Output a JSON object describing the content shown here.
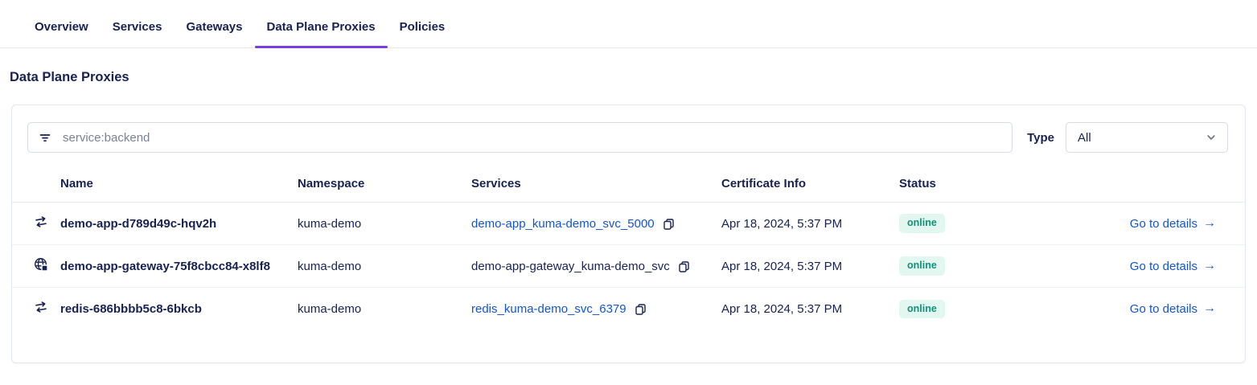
{
  "tabs": [
    {
      "label": "Overview",
      "active": false
    },
    {
      "label": "Services",
      "active": false
    },
    {
      "label": "Gateways",
      "active": false
    },
    {
      "label": "Data Plane Proxies",
      "active": true
    },
    {
      "label": "Policies",
      "active": false
    }
  ],
  "page": {
    "title": "Data Plane Proxies"
  },
  "filter": {
    "placeholder": "service:backend",
    "type_label": "Type",
    "type_value": "All"
  },
  "table": {
    "columns": [
      "Name",
      "Namespace",
      "Services",
      "Certificate Info",
      "Status"
    ],
    "rows": [
      {
        "icon": "proxy-arrows-icon",
        "name": "demo-app-d789d49c-hqv2h",
        "namespace": "kuma-demo",
        "service": "demo-app_kuma-demo_svc_5000",
        "certificate": "Apr 18, 2024, 5:37 PM",
        "status": "online",
        "action": "Go to details",
        "action_arrow": "→"
      },
      {
        "icon": "gateway-globe-icon",
        "name": "demo-app-gateway-75f8cbcc84-x8lf8",
        "namespace": "kuma-demo",
        "service": "demo-app-gateway_kuma-demo_svc",
        "certificate": "Apr 18, 2024, 5:37 PM",
        "status": "online",
        "action": "Go to details",
        "action_arrow": "→"
      },
      {
        "icon": "proxy-arrows-icon",
        "name": "redis-686bbbb5c8-6bkcb",
        "namespace": "kuma-demo",
        "service": "redis_kuma-demo_svc_6379",
        "certificate": "Apr 18, 2024, 5:37 PM",
        "status": "online",
        "action": "Go to details",
        "action_arrow": "→"
      }
    ]
  },
  "colors": {
    "accent_purple": "#7d3ce8",
    "link_blue": "#1456cb",
    "text_navy": "#172252",
    "status_online_text": "#14917b",
    "status_online_bg": "#e1f7ef"
  }
}
